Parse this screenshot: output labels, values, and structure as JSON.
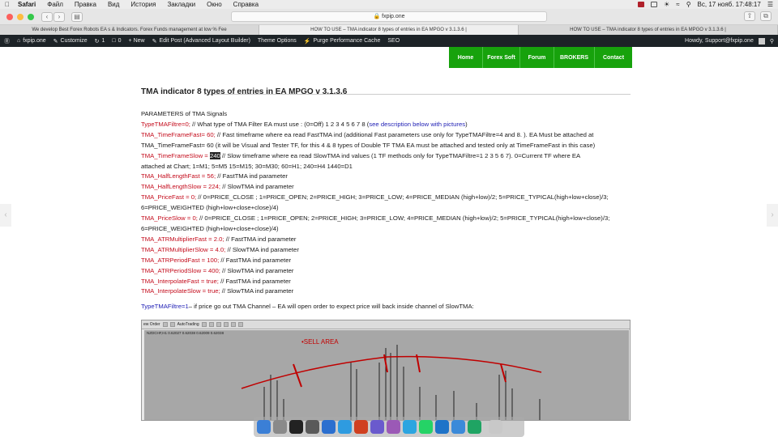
{
  "menubar": {
    "apple": "",
    "app": "Safari",
    "items": [
      "Файл",
      "Правка",
      "Вид",
      "История",
      "Закладки",
      "Окно",
      "Справка"
    ],
    "clock": "Вс, 17 нояб.  17:48:17"
  },
  "browser": {
    "url": "fxpip.one",
    "tabs": [
      "We develop Best Forex Robots EA s & Indicators. Forex Funds management at low % Fee",
      "HOW TO USE – TMA indicator 8 types of entries in EA MPGO v 3.1.3.6 |",
      "HOW TO USE – TMA indicator 8 types of entries in EA MPGO v 3.1.3.6 |"
    ]
  },
  "wpbar": {
    "site": "fxpip.one",
    "customize": "Customize",
    "updates": "1",
    "comments": "0",
    "new": "+ New",
    "edit": "Edit Post (Advanced Layout Builder)",
    "theme": "Theme Options",
    "purge": "Purge Performance Cache",
    "seo": "SEO",
    "howdy": "Howdy, Support@fxpip.one"
  },
  "nav": [
    "Home",
    "Forex Soft",
    "Forum",
    "BROKERS",
    "Contact"
  ],
  "post": {
    "title": "TMA indicator 8 types of entries in EA MPGO v 3.1.3.6",
    "params_heading": "PARAMETERS of TMA Signals",
    "l1a": "TypeTMAFiltre=0;",
    "l1b": " // What type of TMA Filter EA must use : (0=Off) 1 2 3 4 5 6 7 8  (",
    "l1c": "see description below with pictures",
    "l1d": ")",
    "l2a": "TMA_TimeFrameFast= 60;",
    "l2b": " // Fast timeframe where ea read FastTMA ind (additional Fast parameters use only for TypeTMAFiltre=4 and 8. ). EA Must be attached at",
    "l3": "TMA_TimeFrameFast= 60 (it will be Visual and Tester TF, for this 4 & 8 types of Double TF TMA EA must be attached and tested only at TimeFrameFast in this case)",
    "l4a": "TMA_TimeFrameSlow = ",
    "l4b": "240",
    "l4c": " // Slow timeframe where ea read SlowTMA ind values (1 TF methods only for TypeTMAFiltre=1 2 3 5 6 7). 0=Current TF where EA",
    "l5": "attached at Chart; 1=M1; 5=M5 15=M15; 30=M30; 60=H1; 240=H4 1440=D1",
    "l6a": "TMA_HalfLengthFast = 56;",
    "l6b": " // FastTMA ind parameter",
    "l7a": "TMA_HalfLengthSlow = 224;",
    "l7b": " // SlowTMA ind parameter",
    "l8a": "TMA_PriceFast = 0;",
    "l8b": " // 0=PRICE_CLOSE ; 1=PRICE_OPEN; 2=PRICE_HIGH; 3=PRICE_LOW; 4=PRICE_MEDIAN (high+low)/2; 5=PRICE_TYPICAL(high+low+close)/3;",
    "l9": "6=PRICE_WEIGHTED (high+low+close+close)/4)",
    "l10a": "TMA_PriceSlow = 0;",
    "l10b": " // 0=PRICE_CLOSE ; 1=PRICE_OPEN; 2=PRICE_HIGH; 3=PRICE_LOW; 4=PRICE_MEDIAN (high+low)/2; 5=PRICE_TYPICAL(high+low+close)/3;",
    "l11": "6=PRICE_WEIGHTED (high+low+close+close)/4)",
    "l12a": "TMA_ATRMultiplierFast = 2.0;",
    "l12b": " // FastTMA ind parameter",
    "l13a": "TMA_ATRMultiplierSlow = 4.0;",
    "l13b": " // SlowTMA ind parameter",
    "l14a": "TMA_ATRPeriodFast = 100;",
    "l14b": " // FastTMA ind parameter",
    "l15a": "TMA_ATRPeriodSlow = 400;",
    "l15b": " // SlowTMA ind parameter",
    "l16a": "TMA_InterpolateFast = true;",
    "l16b": " // FastTMA ind parameter",
    "l17a": "TMA_InterpolateSlow = true;",
    "l17b": " // SlowTMA ind parameter",
    "l18a": "TypeTMAFiltre=1",
    "l18b": "– if price go out TMA Channel – EA will open order to expect price will back inside channel of SlowTMA:"
  },
  "chart": {
    "toolbar_order": "ew Order",
    "toolbar_auto": "AutoTrading",
    "info": "NZDCHF,H1  0.62027 0.62038 0.62009 0.62038",
    "sell": "•SELL AREA"
  },
  "colors": {
    "red_param": "#c40c1c",
    "blue_param": "#1d1db4",
    "nav_green": "#17a20c"
  }
}
